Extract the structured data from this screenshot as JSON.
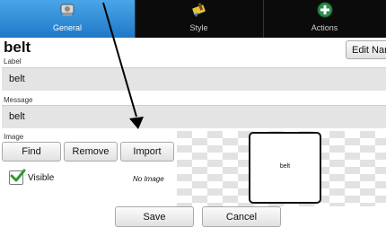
{
  "tabs": [
    {
      "label": "General",
      "icon": "disk-drive-icon"
    },
    {
      "label": "Style",
      "icon": "paint-brush-icon"
    },
    {
      "label": "Actions",
      "icon": "plus-circle-icon"
    }
  ],
  "title": "belt",
  "edit_name_label": "Edit Name",
  "fields": {
    "label": {
      "caption": "Label",
      "value": "belt"
    },
    "message": {
      "caption": "Message",
      "value": "belt"
    },
    "image": {
      "caption": "Image"
    }
  },
  "image_buttons": {
    "find": "Find",
    "remove": "Remove",
    "import": "Import"
  },
  "visible": {
    "label": "Visible",
    "checked": true
  },
  "no_image_text": "No Image",
  "preview_text": "belt",
  "footer": {
    "save": "Save",
    "cancel": "Cancel"
  },
  "colors": {
    "active_tab": "#2a8ad6",
    "tabbar": "#0b0b0b",
    "check": "#2e9a2e",
    "field_bg": "#e4e4e4"
  }
}
